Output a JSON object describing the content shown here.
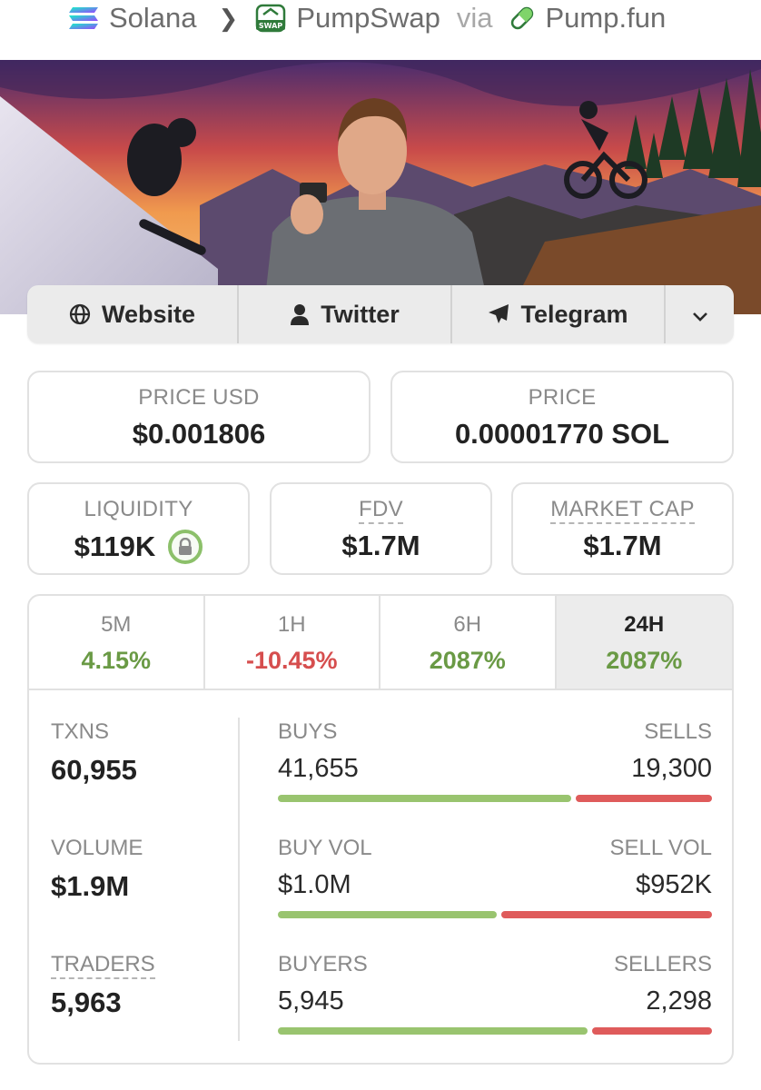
{
  "breadcrumb": {
    "chain": "Solana",
    "dex": "PumpSwap",
    "dex_badge": "SWAP",
    "via": "via",
    "launchpad": "Pump.fun"
  },
  "links": {
    "website": "Website",
    "twitter": "Twitter",
    "telegram": "Telegram"
  },
  "stats": {
    "price_usd_label": "PRICE USD",
    "price_usd": "$0.001806",
    "price_label": "PRICE",
    "price": "0.00001770 SOL",
    "liquidity_label": "LIQUIDITY",
    "liquidity": "$119K",
    "fdv_label": "FDV",
    "fdv": "$1.7M",
    "mcap_label": "MARKET CAP",
    "mcap": "$1.7M"
  },
  "timeframes": [
    {
      "label": "5M",
      "change": "4.15%"
    },
    {
      "label": "1H",
      "change": "-10.45%"
    },
    {
      "label": "6H",
      "change": "2087%"
    },
    {
      "label": "24H",
      "change": "2087%"
    }
  ],
  "details": {
    "txns_label": "TXNS",
    "txns": "60,955",
    "volume_label": "VOLUME",
    "volume": "$1.9M",
    "traders_label": "TRADERS",
    "traders": "5,963",
    "buys_label": "BUYS",
    "buys": "41,655",
    "sells_label": "SELLS",
    "sells": "19,300",
    "buy_vol_label": "BUY VOL",
    "buy_vol": "$1.0M",
    "sell_vol_label": "SELL VOL",
    "sell_vol": "$952K",
    "buyers_label": "BUYERS",
    "buyers": "5,945",
    "sellers_label": "SELLERS",
    "sellers": "2,298"
  },
  "ratios": {
    "buys_fraction": 0.683,
    "buy_vol_fraction": 0.51,
    "buyers_fraction": 0.72
  },
  "colors": {
    "positive": "#6a9a45",
    "negative": "#d64e4e",
    "buy_bar": "#99c46f",
    "sell_bar": "#df5b5b"
  }
}
